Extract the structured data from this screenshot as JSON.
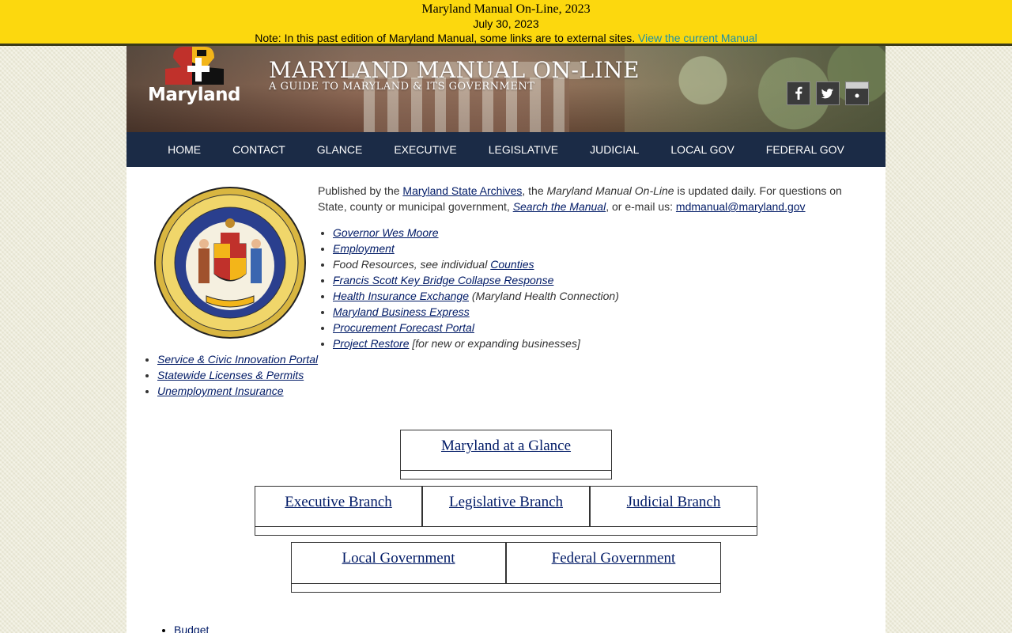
{
  "banner": {
    "title": "Maryland Manual On-Line, 2023",
    "date": "July 30, 2023",
    "note": "Note: In this past edition of Maryland Manual, some links are to external sites.",
    "current_link": "View the current Manual"
  },
  "header": {
    "logo_text": "Maryland",
    "title": "MARYLAND MANUAL ON-LINE",
    "subtitle": "A GUIDE TO MARYLAND & ITS GOVERNMENT",
    "social": [
      "facebook-icon",
      "twitter-icon",
      "flickr-icon"
    ]
  },
  "nav": [
    "HOME",
    "CONTACT",
    "GLANCE",
    "EXECUTIVE",
    "LEGISLATIVE",
    "JUDICIAL",
    "LOCAL GOV",
    "FEDERAL GOV"
  ],
  "intro": {
    "t1": "Published by the ",
    "archives": "Maryland State Archives",
    "t2": ", the ",
    "manual_italic": "Maryland Manual On-Line",
    "t3": " is updated daily. For questions on State, county or municipal government, ",
    "search": "Search the Manual",
    "t4": ", or e-mail us: ",
    "email": "mdmanual@maryland.gov"
  },
  "links": [
    {
      "link": "Governor Wes Moore"
    },
    {
      "link": "Employment"
    },
    {
      "pre": "Food Resources, see individual ",
      "link": "Counties"
    },
    {
      "link": "Francis Scott Key Bridge Collapse Response"
    },
    {
      "link": "Health Insurance Exchange",
      "post": " (Maryland Health Connection)"
    },
    {
      "link": "Maryland Business Express"
    },
    {
      "link": "Procurement Forecast Portal"
    },
    {
      "link": "Project Restore",
      "post": " [for new or expanding businesses]"
    },
    {
      "link": "Service & Civic Innovation Portal"
    },
    {
      "link": "Statewide Licenses & Permits"
    },
    {
      "link": "Unemployment Insurance"
    }
  ],
  "boxes": {
    "glance": "Maryland at a Glance",
    "executive": "Executive Branch",
    "legislative": "Legislative Branch",
    "judicial": "Judicial Branch",
    "local": "Local Government",
    "federal": "Federal Government"
  },
  "bottom": [
    "Budget"
  ]
}
